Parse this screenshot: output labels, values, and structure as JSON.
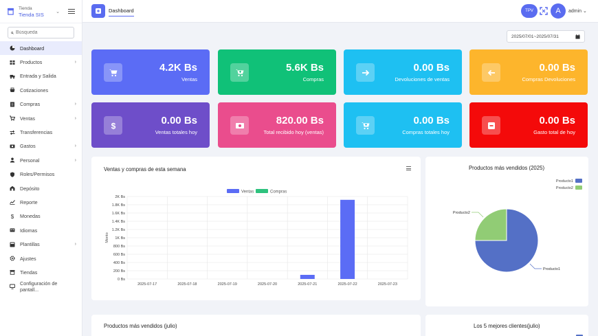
{
  "brand": {
    "line1": "Tienda",
    "line2": "Tienda SIS"
  },
  "search": {
    "placeholder": "Búsqueda"
  },
  "sidebar": {
    "items": [
      {
        "label": "Dashboard",
        "icon": "dashboard-icon",
        "active": true,
        "arrow": false
      },
      {
        "label": "Productos",
        "icon": "products-icon",
        "arrow": true
      },
      {
        "label": "Entrada y Salida",
        "icon": "truck-icon",
        "arrow": false
      },
      {
        "label": "Cotizaciones",
        "icon": "quote-icon",
        "arrow": false
      },
      {
        "label": "Compras",
        "icon": "purchases-icon",
        "arrow": true
      },
      {
        "label": "Ventas",
        "icon": "sales-icon",
        "arrow": true
      },
      {
        "label": "Transferencias",
        "icon": "transfer-icon",
        "arrow": false
      },
      {
        "label": "Gastos",
        "icon": "expenses-icon",
        "arrow": true
      },
      {
        "label": "Personal",
        "icon": "person-icon",
        "arrow": true
      },
      {
        "label": "Roles/Permisos",
        "icon": "shield-icon",
        "arrow": false
      },
      {
        "label": "Depósito",
        "icon": "warehouse-icon",
        "arrow": false
      },
      {
        "label": "Reporte",
        "icon": "report-icon",
        "arrow": false
      },
      {
        "label": "Monedas",
        "icon": "currency-icon",
        "arrow": false
      },
      {
        "label": "Idiomas",
        "icon": "language-icon",
        "arrow": false
      },
      {
        "label": "Plantillas",
        "icon": "template-icon",
        "arrow": true
      },
      {
        "label": "Ajustes",
        "icon": "gear-icon",
        "arrow": false
      },
      {
        "label": "Tiendas",
        "icon": "store-icon",
        "arrow": false
      },
      {
        "label": "Configuración de pantall...",
        "icon": "monitor-icon",
        "arrow": false
      }
    ]
  },
  "header": {
    "tab": "Dashboard",
    "tpv": "TPV",
    "avatar_letter": "A",
    "user": "admin"
  },
  "date_range": "2025/07/01~2025/07/31",
  "cards": [
    {
      "value": "4.2K Bs",
      "label": "Ventas",
      "color": "#5b6cf5",
      "icon": "cart-icon"
    },
    {
      "value": "5.6K Bs",
      "label": "Compras",
      "color": "#10c178",
      "icon": "cart-plus-icon"
    },
    {
      "value": "0.00 Bs",
      "label": "Devoluciones de ventas",
      "color": "#1ec0f2",
      "icon": "arrow-right-icon"
    },
    {
      "value": "0.00 Bs",
      "label": "Compras Devoluciones",
      "color": "#fdb52c",
      "icon": "arrow-left-icon"
    },
    {
      "value": "0.00 Bs",
      "label": "Ventas totales hoy",
      "color": "#6e4ec9",
      "icon": "dollar-icon"
    },
    {
      "value": "820.00 Bs",
      "label": "Total recibido hoy (ventas)",
      "color": "#ea4d8d",
      "icon": "cash-icon"
    },
    {
      "value": "0.00 Bs",
      "label": "Compras totales hoy",
      "color": "#1ec0f2",
      "icon": "cart-plus-icon"
    },
    {
      "value": "0.00 Bs",
      "label": "Gasto total de hoy",
      "color": "#f40a0a",
      "icon": "minus-box-icon"
    }
  ],
  "panels": {
    "weekly_title": "Ventas y compras de esta semana",
    "top_products_title": "Productos más vendidos (2025)",
    "top_products_july_title": "Productos más vendidos (julio)",
    "top_clients_title": "Los 5 mejores clientes(julio)"
  },
  "chart_data": [
    {
      "type": "bar",
      "title": "",
      "ylabel": "Monto",
      "categories": [
        "2025-07-17",
        "2025-07-18",
        "2025-07-19",
        "2025-07-20",
        "2025-07-21",
        "2025-07-22",
        "2025-07-23"
      ],
      "series": [
        {
          "name": "Ventas",
          "color": "#5b6cf5",
          "values": [
            0,
            0,
            0,
            0,
            100,
            1920,
            0
          ]
        },
        {
          "name": "Compras",
          "color": "#2ec27e",
          "values": [
            0,
            0,
            0,
            0,
            0,
            0,
            0
          ]
        }
      ],
      "yticks": [
        "0 Bs",
        "200 Bs",
        "400 Bs",
        "600 Bs",
        "800 Bs",
        "1K Bs",
        "1.2K Bs",
        "1.4K Bs",
        "1.6K Bs",
        "1.8K Bs",
        "2K Bs"
      ],
      "ylim": [
        0,
        2000
      ],
      "legend": "top"
    },
    {
      "type": "pie",
      "labels": [
        "Producto1",
        "Producto2"
      ],
      "colors": [
        "#5470c6",
        "#91cc75"
      ],
      "values": [
        75,
        25
      ],
      "legend": "top-right"
    }
  ]
}
